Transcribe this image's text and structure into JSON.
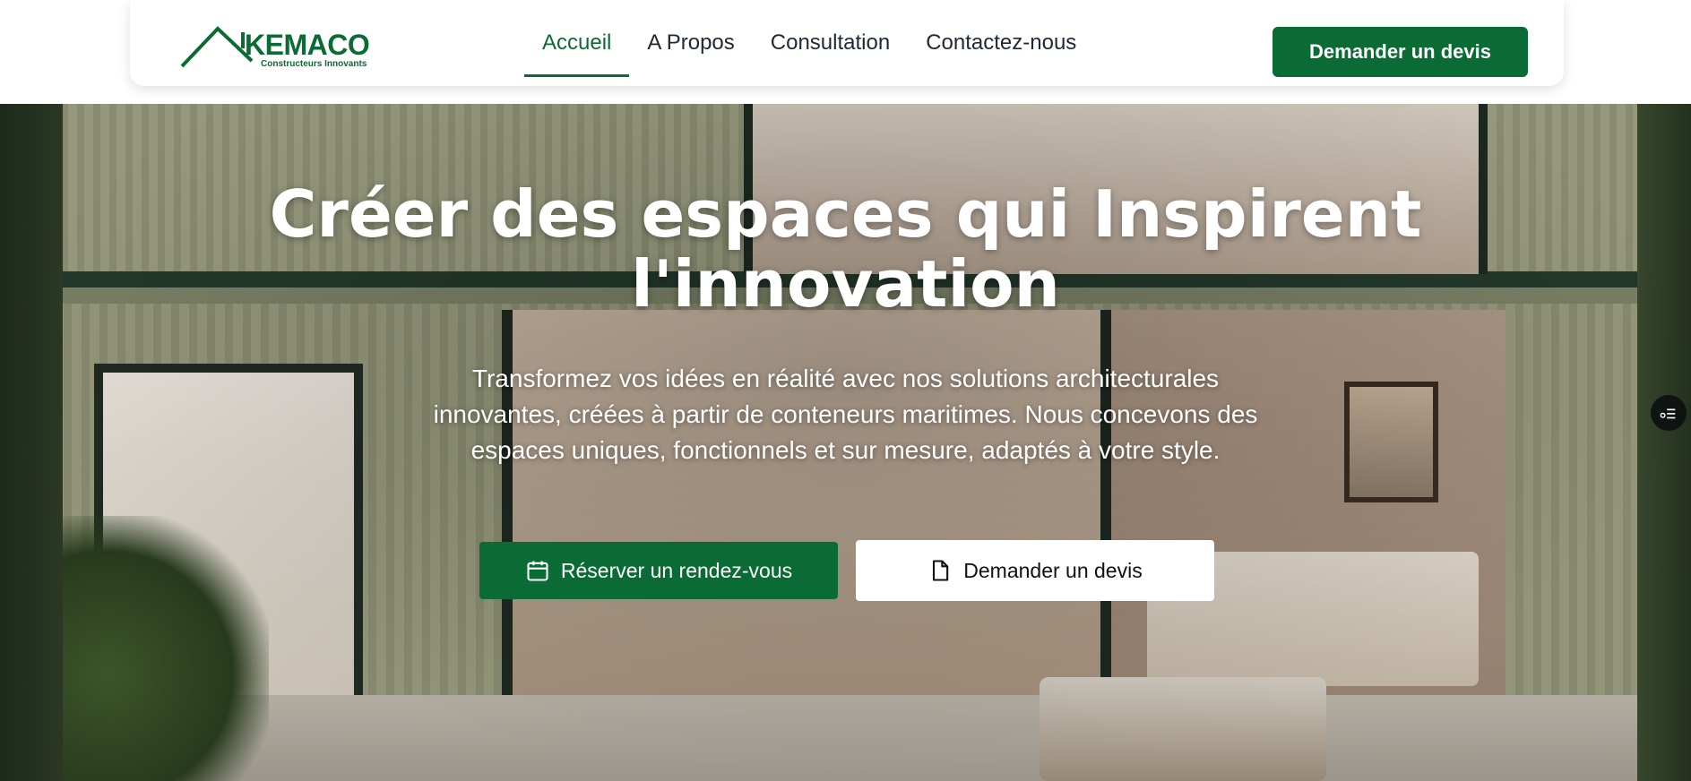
{
  "brand": {
    "name": "KEMACO",
    "tagline": "Constructeurs Innovants",
    "color": "#0b6b34"
  },
  "nav": {
    "links": [
      {
        "label": "Accueil",
        "active": true
      },
      {
        "label": "A Propos",
        "active": false
      },
      {
        "label": "Consultation",
        "active": false
      },
      {
        "label": "Contactez-nous",
        "active": false
      }
    ],
    "cta_label": "Demander un devis"
  },
  "hero": {
    "title": "Créer des espaces qui Inspirent l'innovation",
    "subtitle": "Transformez vos idées en réalité avec nos solutions architecturales innovantes, créées à partir de conteneurs maritimes. Nous concevons des espaces uniques, fonctionnels et sur mesure, adaptés à votre style.",
    "primary_button": {
      "label": "Réserver un rendez-vous",
      "icon": "calendar-icon"
    },
    "secondary_button": {
      "label": "Demander un devis",
      "icon": "document-icon"
    }
  },
  "widgets": {
    "floating_icon": "settings-list-icon"
  }
}
